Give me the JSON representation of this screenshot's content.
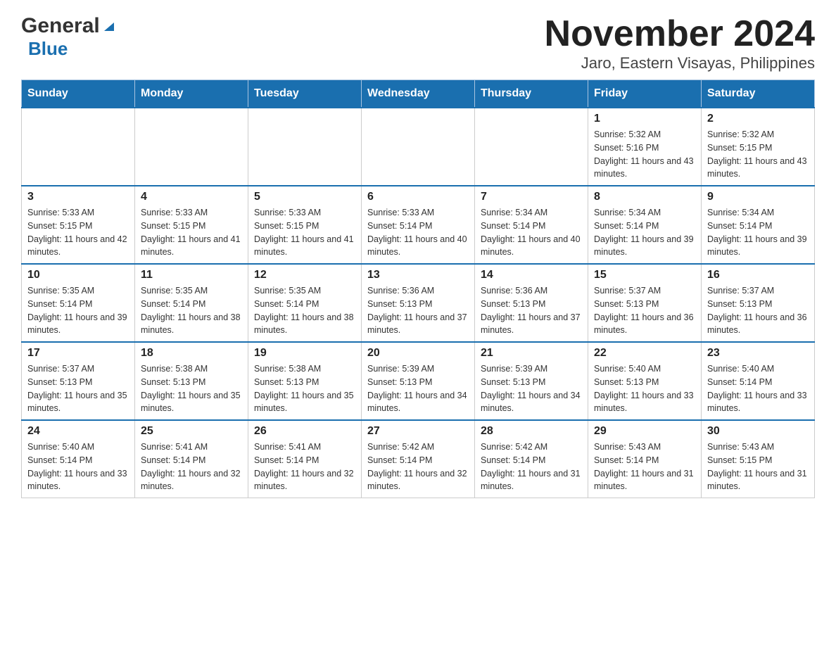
{
  "logo": {
    "general": "General",
    "blue": "Blue"
  },
  "title": "November 2024",
  "subtitle": "Jaro, Eastern Visayas, Philippines",
  "weekdays": [
    "Sunday",
    "Monday",
    "Tuesday",
    "Wednesday",
    "Thursday",
    "Friday",
    "Saturday"
  ],
  "weeks": [
    [
      {
        "day": "",
        "info": ""
      },
      {
        "day": "",
        "info": ""
      },
      {
        "day": "",
        "info": ""
      },
      {
        "day": "",
        "info": ""
      },
      {
        "day": "",
        "info": ""
      },
      {
        "day": "1",
        "info": "Sunrise: 5:32 AM\nSunset: 5:16 PM\nDaylight: 11 hours and 43 minutes."
      },
      {
        "day": "2",
        "info": "Sunrise: 5:32 AM\nSunset: 5:15 PM\nDaylight: 11 hours and 43 minutes."
      }
    ],
    [
      {
        "day": "3",
        "info": "Sunrise: 5:33 AM\nSunset: 5:15 PM\nDaylight: 11 hours and 42 minutes."
      },
      {
        "day": "4",
        "info": "Sunrise: 5:33 AM\nSunset: 5:15 PM\nDaylight: 11 hours and 41 minutes."
      },
      {
        "day": "5",
        "info": "Sunrise: 5:33 AM\nSunset: 5:15 PM\nDaylight: 11 hours and 41 minutes."
      },
      {
        "day": "6",
        "info": "Sunrise: 5:33 AM\nSunset: 5:14 PM\nDaylight: 11 hours and 40 minutes."
      },
      {
        "day": "7",
        "info": "Sunrise: 5:34 AM\nSunset: 5:14 PM\nDaylight: 11 hours and 40 minutes."
      },
      {
        "day": "8",
        "info": "Sunrise: 5:34 AM\nSunset: 5:14 PM\nDaylight: 11 hours and 39 minutes."
      },
      {
        "day": "9",
        "info": "Sunrise: 5:34 AM\nSunset: 5:14 PM\nDaylight: 11 hours and 39 minutes."
      }
    ],
    [
      {
        "day": "10",
        "info": "Sunrise: 5:35 AM\nSunset: 5:14 PM\nDaylight: 11 hours and 39 minutes."
      },
      {
        "day": "11",
        "info": "Sunrise: 5:35 AM\nSunset: 5:14 PM\nDaylight: 11 hours and 38 minutes."
      },
      {
        "day": "12",
        "info": "Sunrise: 5:35 AM\nSunset: 5:14 PM\nDaylight: 11 hours and 38 minutes."
      },
      {
        "day": "13",
        "info": "Sunrise: 5:36 AM\nSunset: 5:13 PM\nDaylight: 11 hours and 37 minutes."
      },
      {
        "day": "14",
        "info": "Sunrise: 5:36 AM\nSunset: 5:13 PM\nDaylight: 11 hours and 37 minutes."
      },
      {
        "day": "15",
        "info": "Sunrise: 5:37 AM\nSunset: 5:13 PM\nDaylight: 11 hours and 36 minutes."
      },
      {
        "day": "16",
        "info": "Sunrise: 5:37 AM\nSunset: 5:13 PM\nDaylight: 11 hours and 36 minutes."
      }
    ],
    [
      {
        "day": "17",
        "info": "Sunrise: 5:37 AM\nSunset: 5:13 PM\nDaylight: 11 hours and 35 minutes."
      },
      {
        "day": "18",
        "info": "Sunrise: 5:38 AM\nSunset: 5:13 PM\nDaylight: 11 hours and 35 minutes."
      },
      {
        "day": "19",
        "info": "Sunrise: 5:38 AM\nSunset: 5:13 PM\nDaylight: 11 hours and 35 minutes."
      },
      {
        "day": "20",
        "info": "Sunrise: 5:39 AM\nSunset: 5:13 PM\nDaylight: 11 hours and 34 minutes."
      },
      {
        "day": "21",
        "info": "Sunrise: 5:39 AM\nSunset: 5:13 PM\nDaylight: 11 hours and 34 minutes."
      },
      {
        "day": "22",
        "info": "Sunrise: 5:40 AM\nSunset: 5:13 PM\nDaylight: 11 hours and 33 minutes."
      },
      {
        "day": "23",
        "info": "Sunrise: 5:40 AM\nSunset: 5:14 PM\nDaylight: 11 hours and 33 minutes."
      }
    ],
    [
      {
        "day": "24",
        "info": "Sunrise: 5:40 AM\nSunset: 5:14 PM\nDaylight: 11 hours and 33 minutes."
      },
      {
        "day": "25",
        "info": "Sunrise: 5:41 AM\nSunset: 5:14 PM\nDaylight: 11 hours and 32 minutes."
      },
      {
        "day": "26",
        "info": "Sunrise: 5:41 AM\nSunset: 5:14 PM\nDaylight: 11 hours and 32 minutes."
      },
      {
        "day": "27",
        "info": "Sunrise: 5:42 AM\nSunset: 5:14 PM\nDaylight: 11 hours and 32 minutes."
      },
      {
        "day": "28",
        "info": "Sunrise: 5:42 AM\nSunset: 5:14 PM\nDaylight: 11 hours and 31 minutes."
      },
      {
        "day": "29",
        "info": "Sunrise: 5:43 AM\nSunset: 5:14 PM\nDaylight: 11 hours and 31 minutes."
      },
      {
        "day": "30",
        "info": "Sunrise: 5:43 AM\nSunset: 5:15 PM\nDaylight: 11 hours and 31 minutes."
      }
    ]
  ]
}
